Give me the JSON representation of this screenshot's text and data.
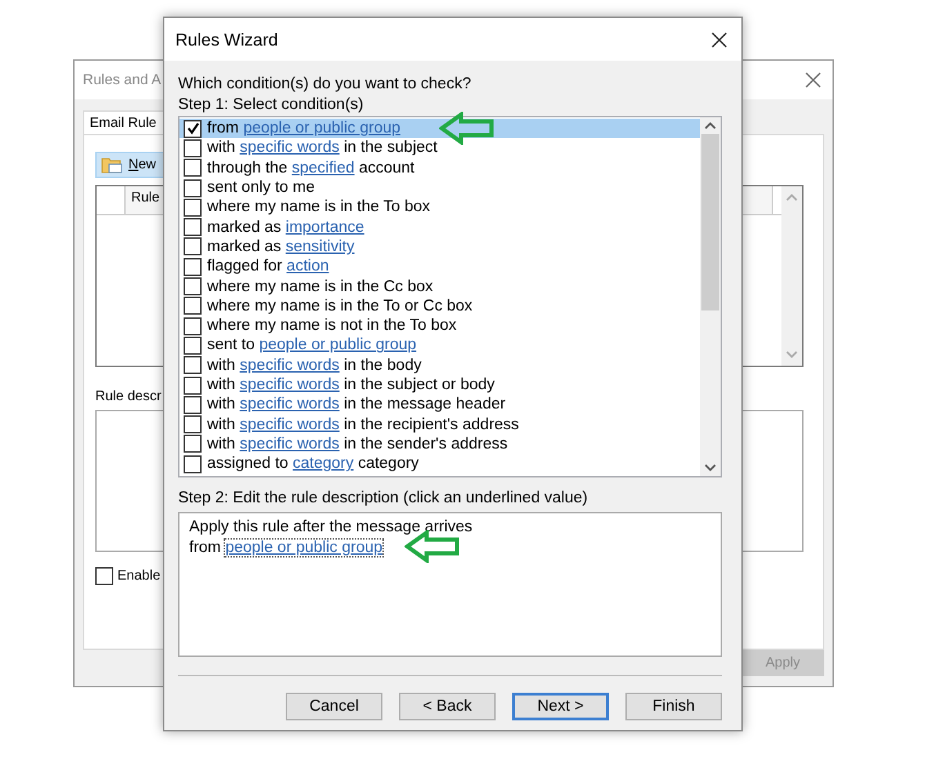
{
  "background_window": {
    "title": "Rules and A",
    "tabs": [
      {
        "label": "Email Rule",
        "selected": true
      }
    ],
    "new_rule_button": "New",
    "rule_list": {
      "columns": [
        "Rule"
      ]
    },
    "description_label": "Rule descr",
    "enable_checkbox": {
      "label": "Enable",
      "checked": false
    },
    "apply_button": {
      "label": "Apply",
      "disabled": true
    }
  },
  "dialog": {
    "title": "Rules Wizard",
    "question": "Which condition(s) do you want to check?",
    "step1_label": "Step 1: Select condition(s)",
    "conditions": [
      {
        "checked": true,
        "selected": true,
        "parts": [
          {
            "kind": "text",
            "text": "from "
          },
          {
            "kind": "link",
            "text": "people or public group"
          }
        ]
      },
      {
        "checked": false,
        "selected": false,
        "parts": [
          {
            "kind": "text",
            "text": "with "
          },
          {
            "kind": "link",
            "text": "specific words"
          },
          {
            "kind": "text",
            "text": " in the subject"
          }
        ]
      },
      {
        "checked": false,
        "selected": false,
        "parts": [
          {
            "kind": "text",
            "text": "through the "
          },
          {
            "kind": "link",
            "text": "specified"
          },
          {
            "kind": "text",
            "text": " account"
          }
        ]
      },
      {
        "checked": false,
        "selected": false,
        "parts": [
          {
            "kind": "text",
            "text": "sent only to me"
          }
        ]
      },
      {
        "checked": false,
        "selected": false,
        "parts": [
          {
            "kind": "text",
            "text": "where my name is in the To box"
          }
        ]
      },
      {
        "checked": false,
        "selected": false,
        "parts": [
          {
            "kind": "text",
            "text": "marked as "
          },
          {
            "kind": "link",
            "text": "importance"
          }
        ]
      },
      {
        "checked": false,
        "selected": false,
        "parts": [
          {
            "kind": "text",
            "text": "marked as "
          },
          {
            "kind": "link",
            "text": "sensitivity"
          }
        ]
      },
      {
        "checked": false,
        "selected": false,
        "parts": [
          {
            "kind": "text",
            "text": "flagged for "
          },
          {
            "kind": "link",
            "text": "action"
          }
        ]
      },
      {
        "checked": false,
        "selected": false,
        "parts": [
          {
            "kind": "text",
            "text": "where my name is in the Cc box"
          }
        ]
      },
      {
        "checked": false,
        "selected": false,
        "parts": [
          {
            "kind": "text",
            "text": "where my name is in the To or Cc box"
          }
        ]
      },
      {
        "checked": false,
        "selected": false,
        "parts": [
          {
            "kind": "text",
            "text": "where my name is not in the To box"
          }
        ]
      },
      {
        "checked": false,
        "selected": false,
        "parts": [
          {
            "kind": "text",
            "text": "sent to "
          },
          {
            "kind": "link",
            "text": "people or public group"
          }
        ]
      },
      {
        "checked": false,
        "selected": false,
        "parts": [
          {
            "kind": "text",
            "text": "with "
          },
          {
            "kind": "link",
            "text": "specific words"
          },
          {
            "kind": "text",
            "text": " in the body"
          }
        ]
      },
      {
        "checked": false,
        "selected": false,
        "parts": [
          {
            "kind": "text",
            "text": "with "
          },
          {
            "kind": "link",
            "text": "specific words"
          },
          {
            "kind": "text",
            "text": " in the subject or body"
          }
        ]
      },
      {
        "checked": false,
        "selected": false,
        "parts": [
          {
            "kind": "text",
            "text": "with "
          },
          {
            "kind": "link",
            "text": "specific words"
          },
          {
            "kind": "text",
            "text": " in the message header"
          }
        ]
      },
      {
        "checked": false,
        "selected": false,
        "parts": [
          {
            "kind": "text",
            "text": "with "
          },
          {
            "kind": "link",
            "text": "specific words"
          },
          {
            "kind": "text",
            "text": " in the recipient's address"
          }
        ]
      },
      {
        "checked": false,
        "selected": false,
        "parts": [
          {
            "kind": "text",
            "text": "with "
          },
          {
            "kind": "link",
            "text": "specific words"
          },
          {
            "kind": "text",
            "text": " in the sender's address"
          }
        ]
      },
      {
        "checked": false,
        "selected": false,
        "parts": [
          {
            "kind": "text",
            "text": "assigned to "
          },
          {
            "kind": "link",
            "text": "category"
          },
          {
            "kind": "text",
            "text": " category"
          }
        ]
      }
    ],
    "step2_label": "Step 2: Edit the rule description (click an underlined value)",
    "description_lines": [
      [
        {
          "kind": "text",
          "text": "Apply this rule after the message arrives"
        }
      ],
      [
        {
          "kind": "text",
          "text": "from "
        },
        {
          "kind": "link",
          "text": "people or public group"
        }
      ]
    ],
    "buttons": [
      {
        "label": "Cancel",
        "default": false
      },
      {
        "label": "< Back",
        "default": false
      },
      {
        "label": "Next >",
        "default": true
      },
      {
        "label": "Finish",
        "default": false
      }
    ]
  }
}
